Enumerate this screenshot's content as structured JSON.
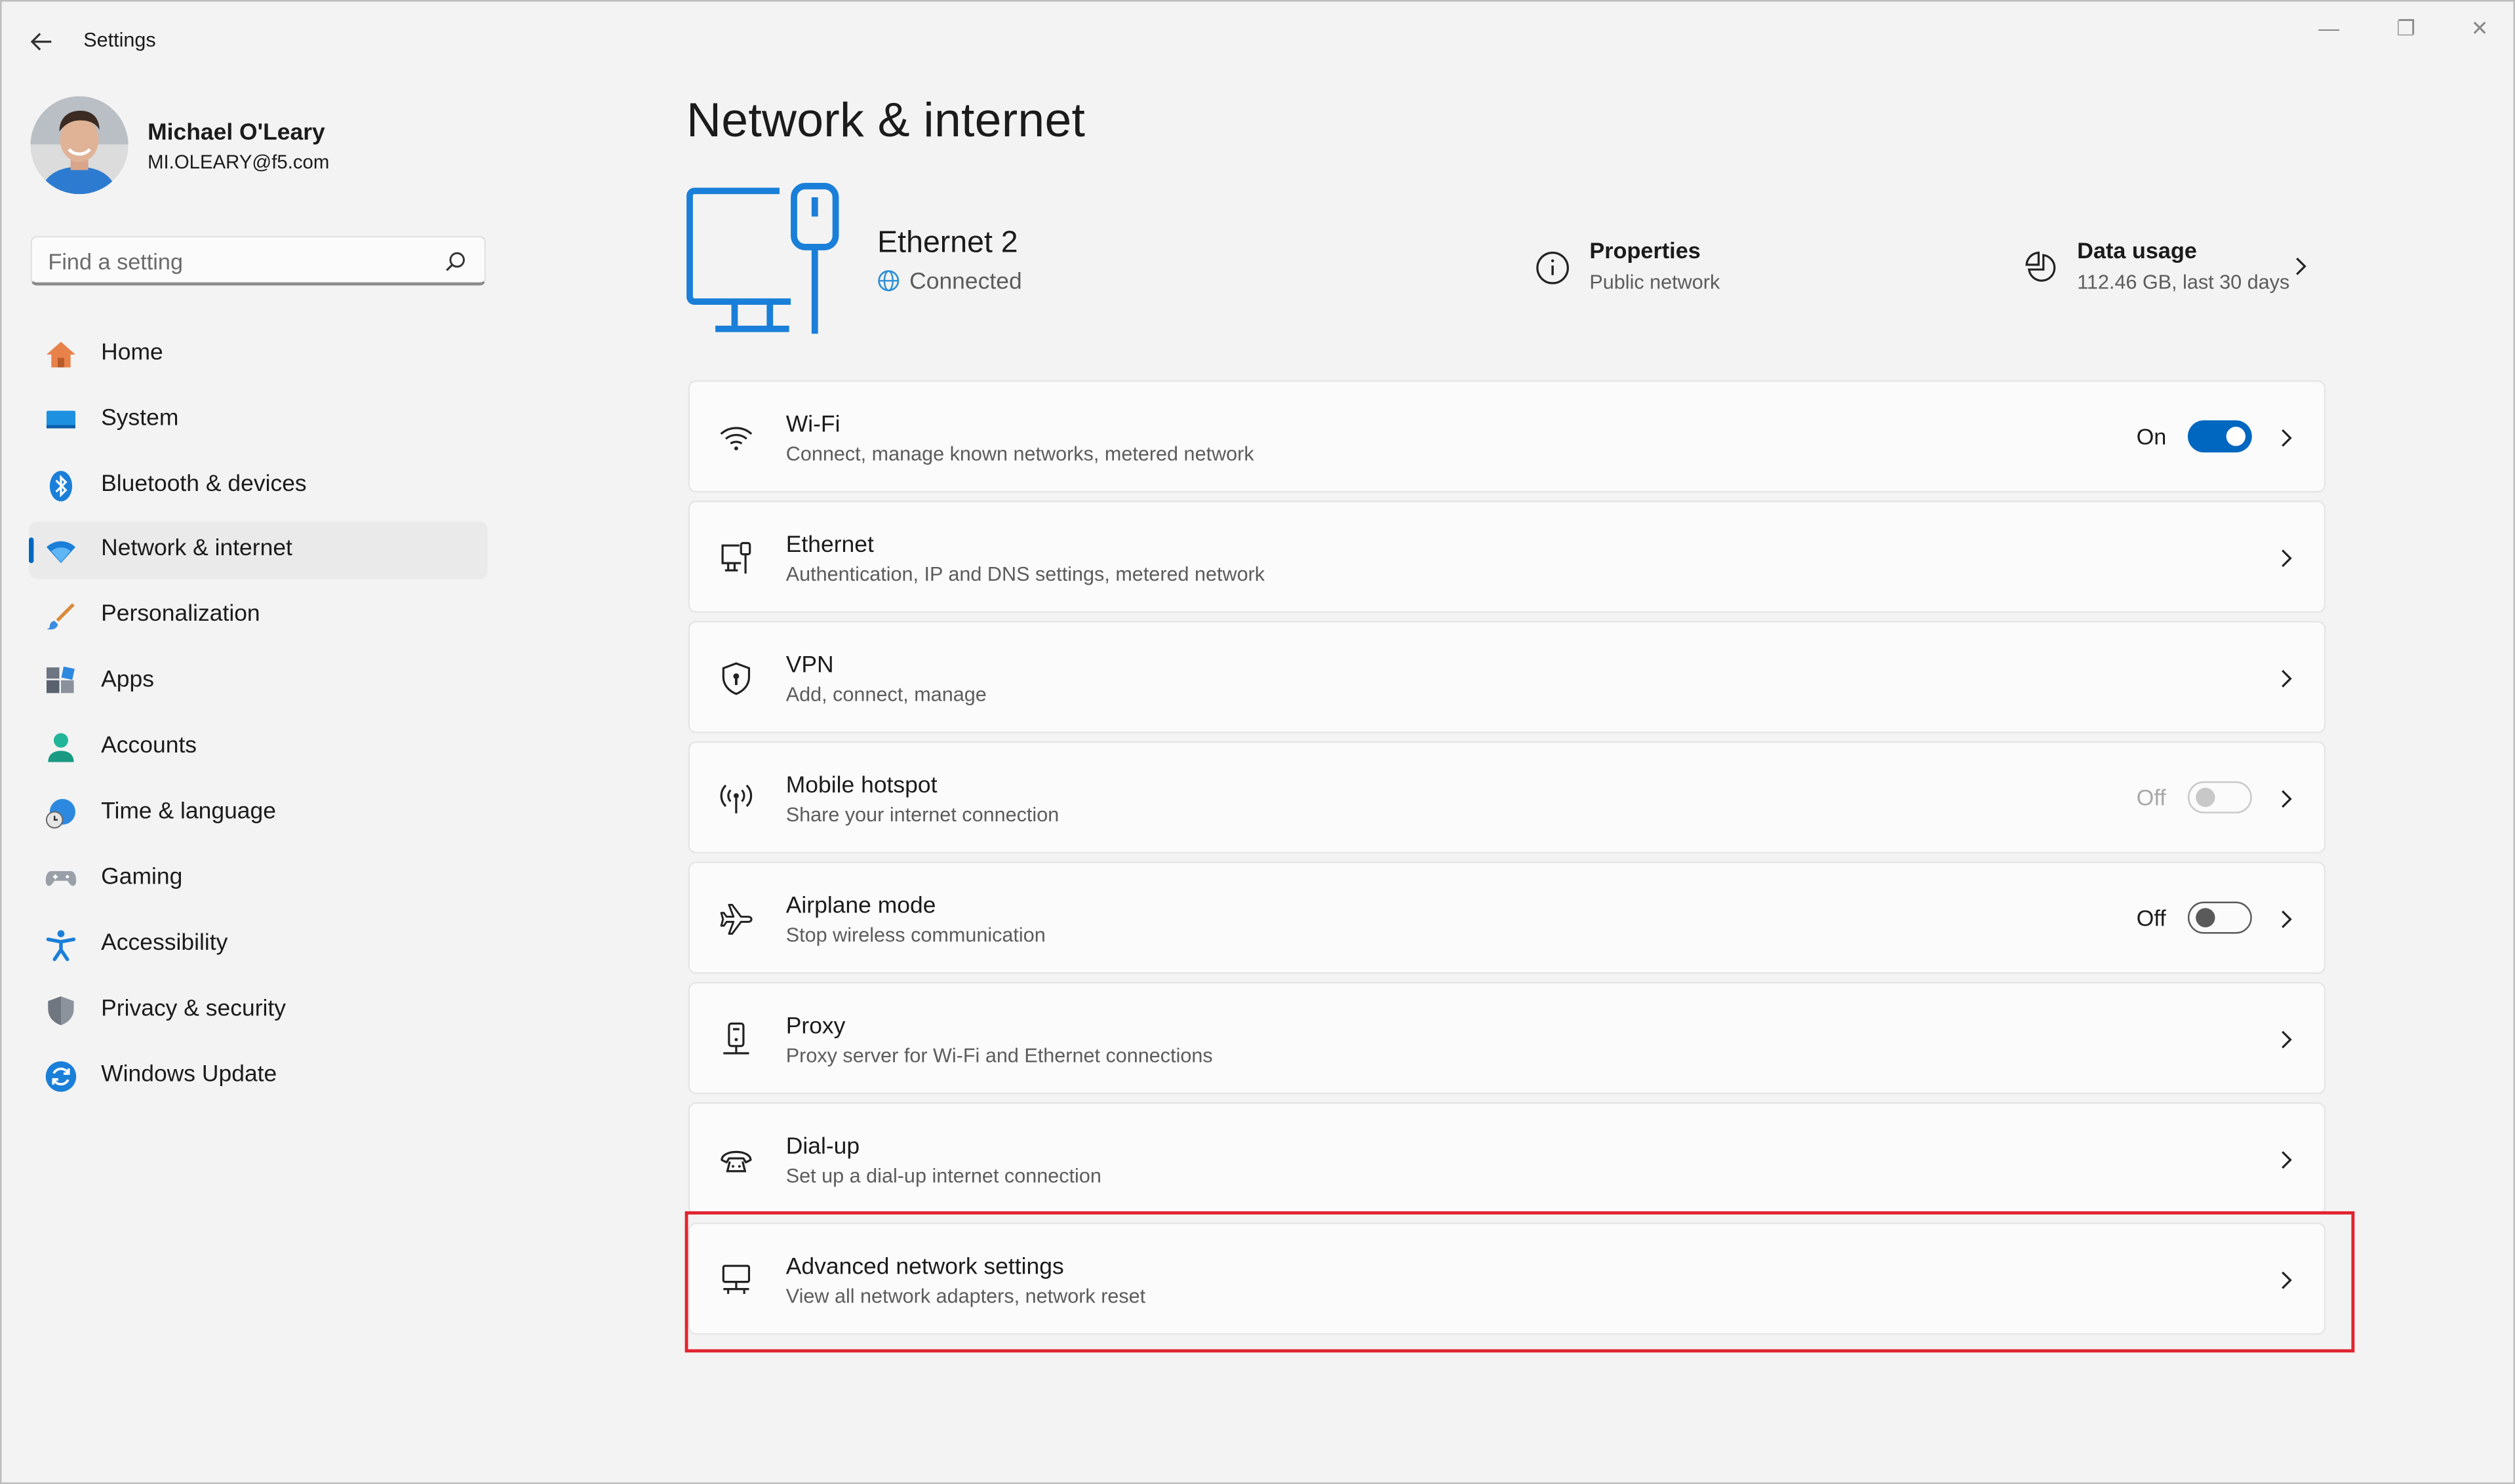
{
  "window": {
    "title": "Settings",
    "back_icon": "back-arrow-icon",
    "minimize": "—",
    "restore": "❐",
    "close": "✕"
  },
  "user": {
    "name": "Michael O'Leary",
    "email": "MI.OLEARY@f5.com"
  },
  "search": {
    "placeholder": "Find a setting"
  },
  "sidebar": {
    "items": [
      {
        "label": "Home",
        "icon": "home-icon"
      },
      {
        "label": "System",
        "icon": "system-icon"
      },
      {
        "label": "Bluetooth & devices",
        "icon": "bluetooth-icon"
      },
      {
        "label": "Network & internet",
        "icon": "wifi-icon",
        "selected": true
      },
      {
        "label": "Personalization",
        "icon": "brush-icon"
      },
      {
        "label": "Apps",
        "icon": "apps-icon"
      },
      {
        "label": "Accounts",
        "icon": "accounts-icon"
      },
      {
        "label": "Time & language",
        "icon": "time-language-icon"
      },
      {
        "label": "Gaming",
        "icon": "gaming-icon"
      },
      {
        "label": "Accessibility",
        "icon": "accessibility-icon"
      },
      {
        "label": "Privacy & security",
        "icon": "shield-icon"
      },
      {
        "label": "Windows Update",
        "icon": "update-icon"
      }
    ]
  },
  "page": {
    "title": "Network & internet"
  },
  "connection": {
    "name": "Ethernet 2",
    "status": "Connected",
    "properties": {
      "title": "Properties",
      "subtitle": "Public network"
    },
    "data_usage": {
      "title": "Data usage",
      "subtitle": "112.46 GB, last 30 days"
    }
  },
  "cards": [
    {
      "title": "Wi-Fi",
      "subtitle": "Connect, manage known networks, metered network",
      "icon": "wifi-icon",
      "toggle": {
        "label": "On",
        "state": "on"
      }
    },
    {
      "title": "Ethernet",
      "subtitle": "Authentication, IP and DNS settings, metered network",
      "icon": "ethernet-icon"
    },
    {
      "title": "VPN",
      "subtitle": "Add, connect, manage",
      "icon": "vpn-shield-icon"
    },
    {
      "title": "Mobile hotspot",
      "subtitle": "Share your internet connection",
      "icon": "hotspot-icon",
      "toggle": {
        "label": "Off",
        "state": "disabled"
      }
    },
    {
      "title": "Airplane mode",
      "subtitle": "Stop wireless communication",
      "icon": "airplane-icon",
      "toggle": {
        "label": "Off",
        "state": "off"
      }
    },
    {
      "title": "Proxy",
      "subtitle": "Proxy server for Wi-Fi and Ethernet connections",
      "icon": "proxy-icon"
    },
    {
      "title": "Dial-up",
      "subtitle": "Set up a dial-up internet connection",
      "icon": "dialup-icon"
    },
    {
      "title": "Advanced network settings",
      "subtitle": "View all network adapters, network reset",
      "icon": "advanced-network-icon"
    }
  ],
  "colors": {
    "accent": "#0067c0",
    "highlight": "#e0242f",
    "background": "#f3f3f3",
    "card": "#fbfbfb"
  }
}
